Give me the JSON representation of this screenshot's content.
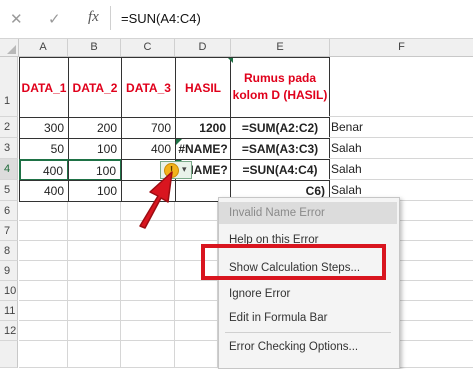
{
  "formula_bar": {
    "cancel_icon": "close-icon",
    "enter_icon": "check-icon",
    "fx_label": "fx",
    "formula": "=SUN(A4:C4)"
  },
  "columns": [
    "A",
    "B",
    "C",
    "D",
    "E",
    "F"
  ],
  "rows": [
    "1",
    "2",
    "3",
    "4",
    "5",
    "6",
    "7",
    "8",
    "9",
    "10",
    "11",
    "12"
  ],
  "header_row": {
    "a": "DATA_1",
    "b": "DATA_2",
    "c": "DATA_3",
    "d": "HASIL",
    "e_line1": "Rumus pada",
    "e_line2": "kolom D (HASIL)"
  },
  "data_rows": [
    {
      "a": "300",
      "b": "200",
      "c": "700",
      "d": "1200",
      "e": "=SUM(A2:C2)",
      "f": "Benar"
    },
    {
      "a": "50",
      "b": "100",
      "c": "400",
      "d": "#NAME?",
      "e": "=SAM(A3:C3)",
      "f": "Salah"
    },
    {
      "a": "400",
      "b": "100",
      "c": "",
      "d": "#NAME?",
      "e": "=SUN(A4:C4)",
      "f": "Salah"
    },
    {
      "a": "400",
      "b": "100",
      "c": "",
      "d": "",
      "e": "C6)",
      "f": "Salah"
    }
  ],
  "error_icon": "warning-icon",
  "context_menu": {
    "items": [
      "Invalid Name Error",
      "Help on this Error",
      "Show Calculation Steps...",
      "Ignore Error",
      "Edit in Formula Bar",
      "Error Checking Options..."
    ]
  },
  "colors": {
    "header_text": "#e0001b",
    "highlight": "#d9151f",
    "arrow": "#d9151f",
    "selection": "#1e7145"
  }
}
